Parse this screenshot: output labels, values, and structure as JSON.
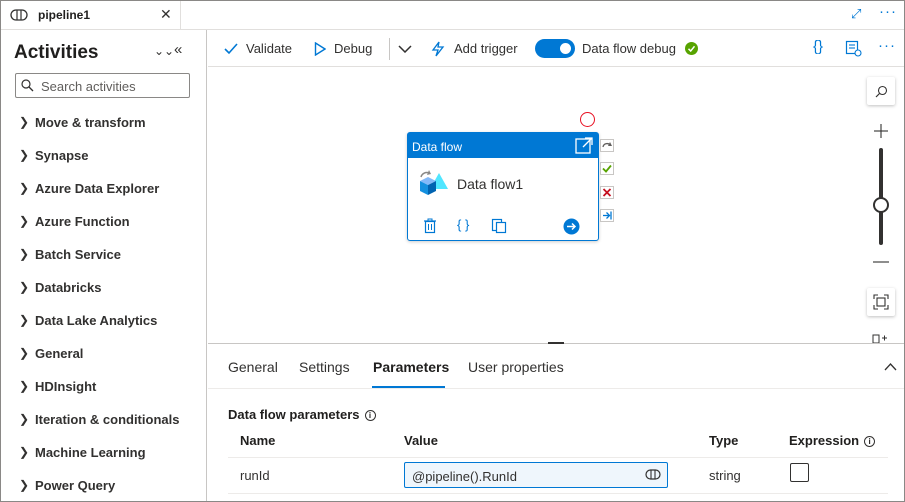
{
  "tab": {
    "title": "pipeline1",
    "close": "✕"
  },
  "window": {
    "expand": "⤢",
    "more": "···"
  },
  "activities": {
    "title": "Activities",
    "search_placeholder": "Search activities",
    "categories": [
      "Move & transform",
      "Synapse",
      "Azure Data Explorer",
      "Azure Function",
      "Batch Service",
      "Databricks",
      "Data Lake Analytics",
      "General",
      "HDInsight",
      "Iteration & conditionals",
      "Machine Learning",
      "Power Query"
    ]
  },
  "toolbar": {
    "validate": "Validate",
    "debug": "Debug",
    "add_trigger": "Add trigger",
    "dataflow_debug": "Data flow debug",
    "code_glyph": "{}",
    "more": "···"
  },
  "node": {
    "header": "Data flow",
    "name": "Data flow1",
    "code_glyph": "{ }"
  },
  "panel": {
    "tabs": [
      "General",
      "Settings",
      "Parameters",
      "User properties"
    ],
    "active_tab": "Parameters",
    "section_title": "Data flow parameters",
    "columns": {
      "name": "Name",
      "value": "Value",
      "type": "Type",
      "expression": "Expression"
    },
    "rows": [
      {
        "name": "runId",
        "value": "@pipeline().RunId",
        "type": "string",
        "expression": false
      }
    ]
  },
  "colors": {
    "accent": "#0078d4",
    "success": "#57a300",
    "error": "#e81123"
  }
}
